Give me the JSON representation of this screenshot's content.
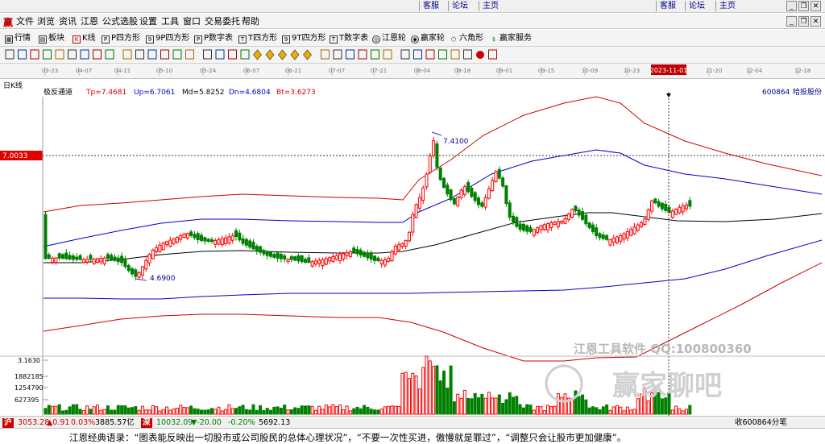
{
  "top": {
    "links_left": [
      "客服",
      "论坛",
      "主页"
    ],
    "links_right": [
      "客服",
      "论坛",
      "主页"
    ]
  },
  "menu": [
    "文件",
    "浏览",
    "资讯",
    "江恩",
    "公式选股",
    "设置",
    "工具",
    "窗口",
    "交易委托",
    "帮助"
  ],
  "toolbar1": [
    "行情",
    "板块",
    "K线",
    "P四方形",
    "9P四方形",
    "P数字表",
    "T四方形",
    "9T四方形",
    "T数字表",
    "江恩轮",
    "赢家轮",
    "六角形",
    "赢家服务"
  ],
  "chart_header": {
    "period": "日K线",
    "indicator": "极反通道",
    "tp": "Tp=7.4681",
    "up": "Up=6.7061",
    "md": "Md=5.8252",
    "dn": "Dn=4.6804",
    "bt": "Bt=3.6273",
    "code": "600864",
    "name": "哈投股份"
  },
  "date_axis": [
    "03-23",
    "04-07",
    "04-21",
    "05-10",
    "05-24",
    "06-07",
    "06-21",
    "07-07",
    "07-21",
    "08-04",
    "08-18",
    "09-01",
    "09-15",
    "10-09",
    "10-23",
    "2023-11-01",
    "11-20",
    "12-04",
    "12-18"
  ],
  "crosshair_price": "7.0033",
  "annotations": {
    "high": "7.4100",
    "low": "4.6900"
  },
  "volume_axis": [
    "3.1630",
    "1882185",
    "1254790",
    "627395"
  ],
  "watermark": {
    "line1": "江恩工具软件  QQ:100800360",
    "line2": "赢家聊吧"
  },
  "status": {
    "sh_index": "3053.28",
    "sh_change": "▲0.91",
    "sh_pct": "0.03%",
    "sh_amount": "3885.57亿",
    "sz_index": "10032.09",
    "sz_change": "▼-20.00",
    "sz_pct": "-0.20%",
    "sz_amount": "5692.13",
    "right": "收600864分笔"
  },
  "footer": "江恩经典语录：“图表能反映出一切股市或公司股民的总体心理状况”，“不要一次性买进，傲慢就是罪过”，“调整只会让股市更加健康”。",
  "colors": {
    "up": "#ff0000",
    "down": "#008000",
    "mid": "#000000",
    "channel_outer": "#cc0000",
    "channel_inner": "#0000cc"
  }
}
